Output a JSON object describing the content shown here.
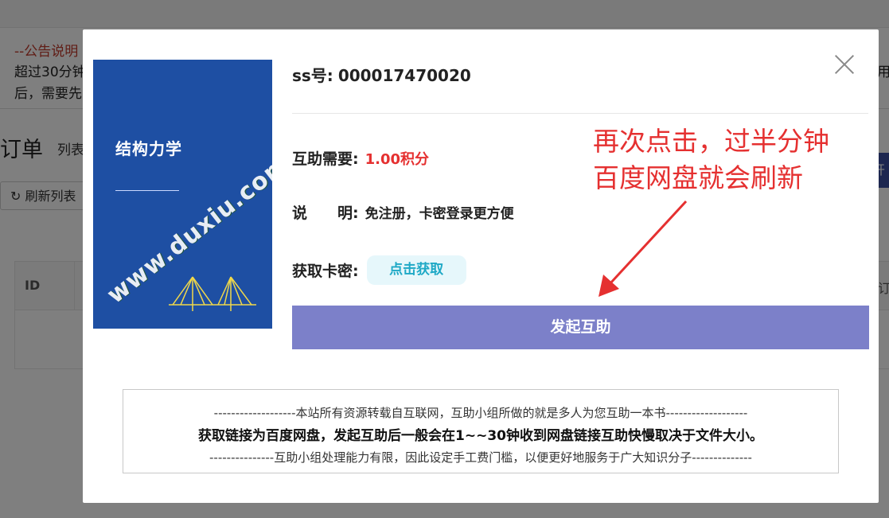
{
  "background": {
    "notice_title": "--公告说明",
    "notice_line1": "超过30分钟",
    "notice_line2": "后，需要先",
    "notice_right": "用",
    "page_title": "订单",
    "page_subtitle": "列表",
    "refresh_label": "刷新列表",
    "right_button_label": "开",
    "table_id_header": "ID",
    "table_right_header": "订"
  },
  "modal": {
    "ss_label": "ss号:",
    "ss_value": "000017470020",
    "cost_label": "互助需要:",
    "cost_value": "1.00积分",
    "desc_label": "说　　明:",
    "desc_value": "免注册，卡密登录更方便",
    "card_label": "获取卡密:",
    "card_button": "点击获取",
    "launch_button": "发起互助",
    "annotation_line1": "再次点击，过半分钟",
    "annotation_line2": "百度网盘就会刷新",
    "info_line1": "-------------------本站所有资源转载自互联网，互助小组所做的就是多人为您互助一本书-------------------",
    "info_line2": "获取链接为百度网盘，发起互助后一般会在1~~30钟收到网盘链接互助快慢取决于文件大小。",
    "info_line3": "---------------互助小组处理能力有限，因此设定手工费门槛，以便更好地服务于广大知识分子--------------",
    "cover": {
      "title": "结构力学",
      "watermark": "www.duxiu.com",
      "color": "#1e4fa3"
    }
  },
  "colors": {
    "accent_red": "#e53030",
    "launch_button": "#7c80c9",
    "card_button_bg": "#e6f7fb",
    "card_button_text": "#1fa9c6"
  }
}
